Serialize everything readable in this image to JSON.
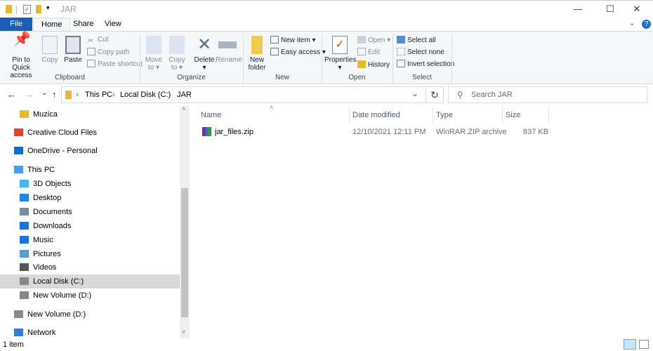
{
  "window": {
    "title": "JAR",
    "minimize": "—",
    "maximize": "☐",
    "close": "✕"
  },
  "tabs": [
    {
      "label": "File"
    },
    {
      "label": "Home"
    },
    {
      "label": "Share"
    },
    {
      "label": "View"
    }
  ],
  "ribbon": {
    "clipboard": {
      "pin": "Pin to Quick access",
      "pin1": "Pin to Quick",
      "pin2": "access",
      "copy": "Copy",
      "paste": "Paste",
      "cut": "Cut",
      "copy_path": "Copy path",
      "paste_shortcut": "Paste shortcut",
      "group": "Clipboard"
    },
    "organize": {
      "move1": "Move",
      "move2": "to ▾",
      "copy1": "Copy",
      "copy2": "to ▾",
      "delete": "Delete",
      "delete_arrow": "▾",
      "rename": "Rename",
      "group": "Organize"
    },
    "new": {
      "new_item": "New item ▾",
      "easy_access": "Easy access ▾",
      "nf1": "New",
      "nf2": "folder",
      "group": "New"
    },
    "open": {
      "properties": "Properties",
      "prop_arrow": "▾",
      "open": "Open ▾",
      "edit": "Edit",
      "history": "History",
      "group": "Open"
    },
    "select": {
      "select_all": "Select all",
      "select_none": "Select none",
      "invert": "Invert selection",
      "group": "Select"
    }
  },
  "address": {
    "back": "←",
    "forward": "→",
    "recent": "⌄",
    "up": "↑",
    "crumbs": [
      "This PC",
      "Local Disk (C:)",
      "JAR"
    ],
    "search_placeholder": "Search JAR",
    "refresh": "↻",
    "dropdown": "⌄"
  },
  "nav": [
    {
      "label": "Muzica",
      "icon": "folder-icon",
      "color": "#e8b931"
    },
    {
      "label": "Creative Cloud Files",
      "icon": "creative-cloud-icon",
      "color": "#e0442a"
    },
    {
      "label": "OneDrive - Personal",
      "icon": "cloud-icon",
      "color": "#0f6fd1"
    },
    {
      "label": "This PC",
      "icon": "computer-icon",
      "color": "#4aa0e0"
    },
    {
      "label": "3D Objects",
      "icon": "cube-icon",
      "color": "#48b6e8"
    },
    {
      "label": "Desktop",
      "icon": "desktop-icon",
      "color": "#1e88e5"
    },
    {
      "label": "Documents",
      "icon": "document-icon",
      "color": "#7a8aa0"
    },
    {
      "label": "Downloads",
      "icon": "download-icon",
      "color": "#1e74d6"
    },
    {
      "label": "Music",
      "icon": "music-icon",
      "color": "#1e74d6"
    },
    {
      "label": "Pictures",
      "icon": "picture-icon",
      "color": "#5a9bd6"
    },
    {
      "label": "Videos",
      "icon": "video-icon",
      "color": "#555"
    },
    {
      "label": "Local Disk (C:)",
      "icon": "drive-icon",
      "color": "#888"
    },
    {
      "label": "New Volume (D:)",
      "icon": "drive-icon",
      "color": "#888"
    },
    {
      "label": "New Volume (D:)",
      "icon": "drive-icon",
      "color": "#888"
    },
    {
      "label": "Network",
      "icon": "network-icon",
      "color": "#3a7bd5"
    }
  ],
  "columns": {
    "name": "Name",
    "date": "Date modified",
    "type": "Type",
    "size": "Size"
  },
  "files": [
    {
      "name": "jar_files.zip",
      "date": "12/10/2021 12:11 PM",
      "type": "WinRAR ZIP archive",
      "size": "837 KB"
    }
  ],
  "status": {
    "count": "1 item"
  },
  "colors": {
    "accent": "#1a5fb4",
    "selected": "#d9d9d9"
  }
}
